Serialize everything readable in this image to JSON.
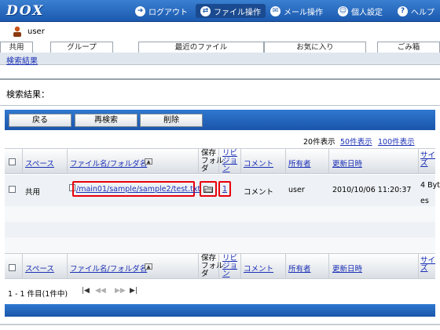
{
  "header": {
    "logo": "DOX",
    "nav": [
      {
        "label": "ログアウト",
        "icon": "logout-icon",
        "glyph": "➜"
      },
      {
        "label": "ファイル操作",
        "icon": "file-ops-icon",
        "glyph": "⇄"
      },
      {
        "label": "メール操作",
        "icon": "mail-icon",
        "glyph": "✉"
      },
      {
        "label": "個人設定",
        "icon": "user-settings-icon",
        "glyph": "☺"
      },
      {
        "label": "ヘルプ",
        "icon": "help-icon",
        "glyph": "?"
      }
    ]
  },
  "user": {
    "name": "user"
  },
  "tabs": [
    "共用",
    "グループ",
    "最近のファイル",
    "お気に入り",
    "ごみ箱"
  ],
  "breadcrumb": "検索結果",
  "section_title": "検索結果：",
  "actions": {
    "back": "戻る",
    "research": "再検索",
    "delete": "削除"
  },
  "paging": {
    "current": "20件表示",
    "options": [
      "50件表示",
      "100件表示"
    ]
  },
  "columns": {
    "space": "スペース",
    "name": "ファイル名/フォルダ名",
    "folder": [
      "保存",
      "フォル",
      "ダ"
    ],
    "revision": [
      "リビ",
      "ジョ",
      "ン"
    ],
    "comment": "コメント",
    "owner": "所有者",
    "updated": "更新日時",
    "size": [
      "サイ",
      "ズ"
    ]
  },
  "rows": [
    {
      "space": "共用",
      "path": "/main01/sample/sample2/test.txt",
      "revision": "1",
      "comment": "コメント",
      "owner": "user",
      "updated": "2010/10/06 11:20:37",
      "size": [
        "4 Byt",
        "es"
      ]
    }
  ],
  "footer": {
    "range": "1 - 1 件目(1件中)",
    "pager": [
      "|◀",
      "◀◀",
      "▶▶",
      "▶|"
    ]
  },
  "colors": {
    "accent": "#1b5ab0",
    "link": "#1a2fb5",
    "highlight": "#e8000a"
  }
}
